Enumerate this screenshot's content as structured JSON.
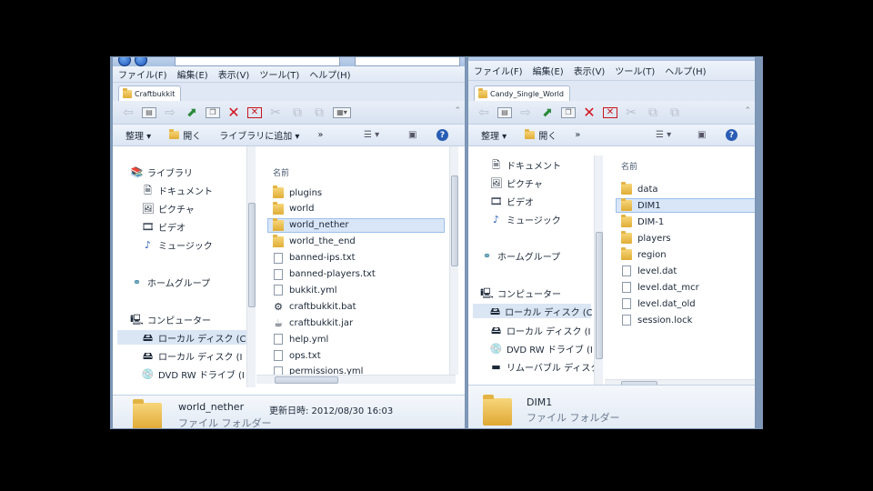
{
  "left_window": {
    "menu": [
      "ファイル(F)",
      "編集(E)",
      "表示(V)",
      "ツール(T)",
      "ヘルプ(H)"
    ],
    "tab_title": "Craftbukkit",
    "commands": {
      "organize": "整理 ▾",
      "open": "開く",
      "add_library": "ライブラリに追加 ▾",
      "more": "»"
    },
    "nav": [
      "ライブラリ",
      "ドキュメント",
      "ピクチャ",
      "ビデオ",
      "ミュージック",
      "ホームグループ",
      "コンピューター",
      "ローカル ディスク (C",
      "ローカル ディスク (I",
      "DVD RW ドライブ (I"
    ],
    "column_name": "名前",
    "files": [
      {
        "name": "plugins",
        "type": "folder"
      },
      {
        "name": "world",
        "type": "folder"
      },
      {
        "name": "world_nether",
        "type": "folder"
      },
      {
        "name": "world_the_end",
        "type": "folder"
      },
      {
        "name": "banned-ips.txt",
        "type": "file"
      },
      {
        "name": "banned-players.txt",
        "type": "file"
      },
      {
        "name": "bukkit.yml",
        "type": "file"
      },
      {
        "name": "craftbukkit.bat",
        "type": "bat"
      },
      {
        "name": "craftbukkit.jar",
        "type": "jar"
      },
      {
        "name": "help.yml",
        "type": "file"
      },
      {
        "name": "ops.txt",
        "type": "file"
      },
      {
        "name": "permissions.yml",
        "type": "file"
      }
    ],
    "selected_index": 2,
    "detail": {
      "name": "world_nether",
      "type": "ファイル フォルダー",
      "modified": "更新日時: 2012/08/30 16:03"
    }
  },
  "right_window": {
    "menu": [
      "ファイル(F)",
      "編集(E)",
      "表示(V)",
      "ツール(T)",
      "ヘルプ(H)"
    ],
    "tab_title": "Candy_Single_World",
    "commands": {
      "organize": "整理 ▾",
      "open": "開く",
      "more": "»"
    },
    "nav": [
      "ドキュメント",
      "ピクチャ",
      "ビデオ",
      "ミュージック",
      "ホームグループ",
      "コンピューター",
      "ローカル ディスク (C",
      "ローカル ディスク (I",
      "DVD RW ドライブ (I",
      "リムーバブル ディスク"
    ],
    "column_name": "名前",
    "files": [
      {
        "name": "data",
        "type": "folder"
      },
      {
        "name": "DIM1",
        "type": "folder"
      },
      {
        "name": "DIM-1",
        "type": "folder"
      },
      {
        "name": "players",
        "type": "folder"
      },
      {
        "name": "region",
        "type": "folder"
      },
      {
        "name": "level.dat",
        "type": "file"
      },
      {
        "name": "level.dat_mcr",
        "type": "file"
      },
      {
        "name": "level.dat_old",
        "type": "file"
      },
      {
        "name": "session.lock",
        "type": "file"
      }
    ],
    "selected_index": 1,
    "detail": {
      "name": "DIM1",
      "type": "ファイル フォルダー"
    }
  }
}
